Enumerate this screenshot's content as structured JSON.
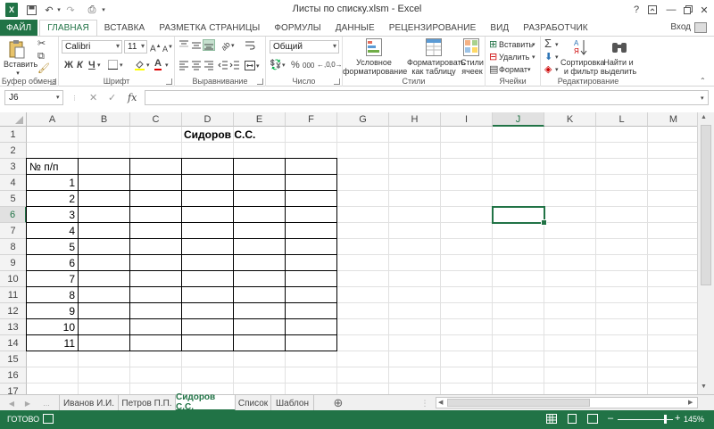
{
  "window": {
    "title": "Листы по списку.xlsm - Excel",
    "help": "?",
    "minimize": "—",
    "close": "✕"
  },
  "tabs": [
    {
      "label": "ФАЙЛ"
    },
    {
      "label": "ГЛАВНАЯ"
    },
    {
      "label": "ВСТАВКА"
    },
    {
      "label": "РАЗМЕТКА СТРАНИЦЫ"
    },
    {
      "label": "ФОРМУЛЫ"
    },
    {
      "label": "ДАННЫЕ"
    },
    {
      "label": "РЕЦЕНЗИРОВАНИЕ"
    },
    {
      "label": "ВИД"
    },
    {
      "label": "РАЗРАБОТЧИК"
    }
  ],
  "login": "Вход",
  "ribbon": {
    "clipboard": {
      "label": "Буфер обмена",
      "paste": "Вставить"
    },
    "font": {
      "label": "Шрифт",
      "name": "Calibri",
      "size": "11",
      "bold": "Ж",
      "italic": "К",
      "underline": "Ч"
    },
    "alignment": {
      "label": "Выравнивание"
    },
    "number": {
      "label": "Число",
      "format": "Общий",
      "percent": "%",
      "thousands": "000"
    },
    "styles": {
      "label": "Стили",
      "cond_l1": "Условное",
      "cond_l2": "форматирование",
      "table_l1": "Форматировать",
      "table_l2": "как таблицу",
      "cell_l1": "Стили",
      "cell_l2": "ячеек"
    },
    "cells": {
      "label": "Ячейки",
      "insert": "Вставить",
      "delete": "Удалить",
      "format": "Формат"
    },
    "editing": {
      "label": "Редактирование",
      "sort_l1": "Сортировка",
      "sort_l2": "и фильтр",
      "find_l1": "Найти и",
      "find_l2": "выделить"
    }
  },
  "formula_bar": {
    "name_box": "J6",
    "fx": "fx",
    "value": ""
  },
  "columns": [
    "A",
    "B",
    "C",
    "D",
    "E",
    "F",
    "G",
    "H",
    "I",
    "J",
    "K",
    "L",
    "M"
  ],
  "rows": [
    "1",
    "2",
    "3",
    "4",
    "5",
    "6",
    "7",
    "8",
    "9",
    "10",
    "11",
    "12",
    "13",
    "14",
    "15",
    "16",
    "17"
  ],
  "cells": {
    "title": "Сидоров С.С.",
    "header": "№ п/п",
    "numbers": [
      "1",
      "2",
      "3",
      "4",
      "5",
      "6",
      "7",
      "8",
      "9",
      "10",
      "11"
    ]
  },
  "sheets": [
    "Иванов И.И.",
    "Петров П.П.",
    "Сидоров С.С.",
    "Список",
    "Шаблон"
  ],
  "add_sheet": "⊕",
  "status": {
    "ready": "ГОТОВО",
    "zoom": "145%",
    "zoom_minus": "–",
    "zoom_plus": "+"
  }
}
